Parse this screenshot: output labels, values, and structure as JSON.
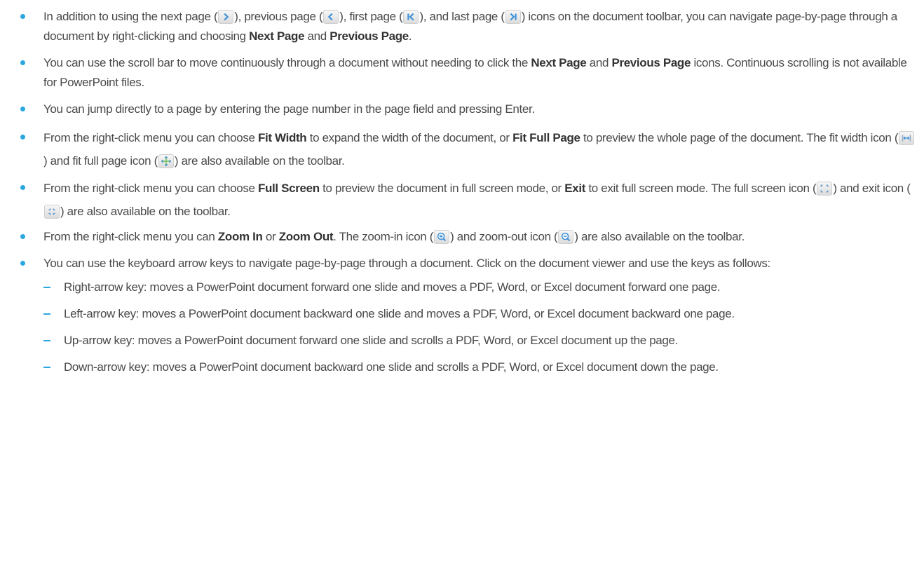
{
  "items": [
    {
      "parts": [
        "In addition to using the next page (",
        ") , previous page (",
        "), first page (",
        "), and last page (",
        ") icons on the document toolbar, you can navigate page-by-page through a document by right-clicking and choosing ",
        "Next Page",
        " and ",
        "Previous Page",
        "."
      ]
    },
    {
      "parts": [
        "You can use the scroll bar to move continuously through a document without needing to click the ",
        "Next Page",
        " and ",
        "Previous Page",
        " icons. Continuous scrolling is not available for PowerPoint files."
      ]
    },
    {
      "text": "You can jump directly to a page by entering the page number in the page field and pressing Enter."
    },
    {
      "parts": [
        "From the right-click menu you can choose ",
        "Fit Width",
        " to expand the width of the document, or ",
        "Fit Full Page",
        " to preview the whole page of the document. The fit width icon (",
        ") and fit full page icon (",
        ") are also available on the toolbar."
      ]
    },
    {
      "parts": [
        "From the right-click menu you can choose ",
        "Full Screen",
        " to preview the document in full screen mode, or ",
        "Exit",
        " to exit full screen mode. The full screen icon (",
        ") and exit icon (",
        ") are also available on the toolbar."
      ]
    },
    {
      "parts": [
        "From the right-click menu you can ",
        "Zoom In",
        " or ",
        "Zoom Out",
        ". The zoom-in icon (",
        ") and zoom-out icon (",
        ") are also available on the toolbar."
      ]
    },
    {
      "text": "You can use the keyboard arrow keys to navigate page-by-page through a document. Click on the document viewer and use the keys as follows:",
      "sub": [
        "Right-arrow key: moves a PowerPoint document forward one slide and moves a PDF, Word, or Excel document forward one page.",
        "Left-arrow key: moves a PowerPoint document backward one slide and moves a PDF, Word, or Excel document backward one page.",
        "Up-arrow key: moves a PowerPoint document forward one slide and scrolls a PDF, Word, or Excel document up the page.",
        "Down-arrow key: moves a PowerPoint document backward one slide and scrolls a PDF, Word, or Excel document down the page."
      ]
    }
  ],
  "icons": [
    "next-page-icon",
    "previous-page-icon",
    "first-page-icon",
    "last-page-icon",
    "fit-width-icon",
    "fit-full-page-icon",
    "full-screen-icon",
    "exit-full-screen-icon",
    "zoom-in-icon",
    "zoom-out-icon"
  ],
  "colors": {
    "bullet": "#2aa7df",
    "text": "#4a4a4a"
  }
}
